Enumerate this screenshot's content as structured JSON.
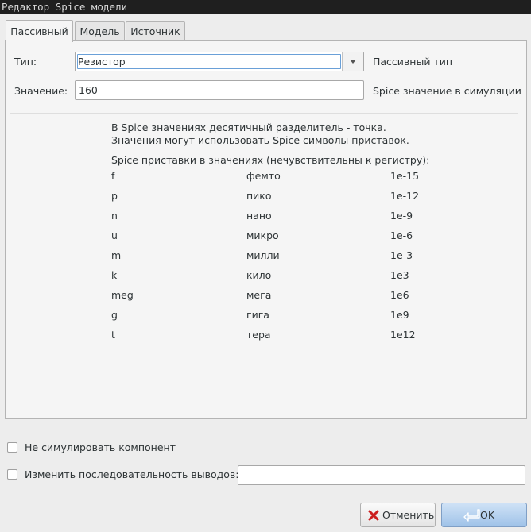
{
  "window": {
    "title": "Редактор Spice модели"
  },
  "tabs": [
    {
      "label": "Пассивный",
      "active": true
    },
    {
      "label": "Модель",
      "active": false
    },
    {
      "label": "Источник",
      "active": false
    }
  ],
  "form": {
    "type_label": "Тип:",
    "type_value": "Резистор",
    "type_hint": "Пассивный тип",
    "value_label": "Значение:",
    "value_value": "160",
    "value_hint": "Spice значение в симуляции"
  },
  "info": {
    "line1": "В Spice значениях десятичный разделитель - точка.",
    "line2": "Значения могут использовать Spice символы приставок.",
    "prefixes_header": "Spice приставки в значениях (нечувствительны к регистру):",
    "prefixes": [
      {
        "symbol": "f",
        "name": "фемто",
        "factor": "1e-15"
      },
      {
        "symbol": "p",
        "name": "пико",
        "factor": "1e-12"
      },
      {
        "symbol": "n",
        "name": "нано",
        "factor": "1e-9"
      },
      {
        "symbol": "u",
        "name": "микро",
        "factor": "1e-6"
      },
      {
        "symbol": "m",
        "name": "милли",
        "factor": "1e-3"
      },
      {
        "symbol": "k",
        "name": "кило",
        "factor": "1e3"
      },
      {
        "symbol": "meg",
        "name": "мега",
        "factor": "1e6"
      },
      {
        "symbol": "g",
        "name": "гига",
        "factor": "1e9"
      },
      {
        "symbol": "t",
        "name": "тера",
        "factor": "1e12"
      }
    ]
  },
  "options": {
    "disable_sim_label": "Не симулировать компонент",
    "disable_sim_checked": false,
    "alt_pins_label": "Изменить последовательность выводов:",
    "alt_pins_checked": false,
    "alt_pins_value": ""
  },
  "buttons": {
    "cancel_label": "Отменить",
    "ok_label": "OK"
  },
  "colors": {
    "accent": "#9fc2e8",
    "cancel_icon": "#cc1f1f"
  }
}
